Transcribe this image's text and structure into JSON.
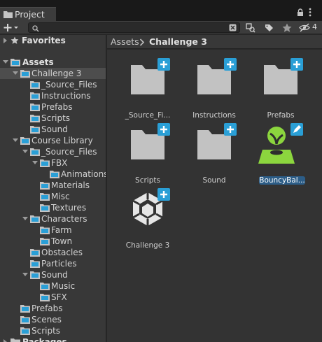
{
  "tab": {
    "label": "Project"
  },
  "toolbar": {
    "search_placeholder": "",
    "hidden_count": "4"
  },
  "tree": {
    "favorites": "Favorites",
    "assets": "Assets",
    "challenge3": "Challenge 3",
    "source_files": "_Source_Files",
    "instructions": "Instructions",
    "prefabs": "Prefabs",
    "scripts": "Scripts",
    "sound": "Sound",
    "course_library": "Course Library",
    "cl_source_files": "_Source_Files",
    "fbx": "FBX",
    "animations": "Animations",
    "materials": "Materials",
    "misc": "Misc",
    "textures": "Textures",
    "characters": "Characters",
    "farm": "Farm",
    "town": "Town",
    "obstacles": "Obstacles",
    "particles": "Particles",
    "cl_sound": "Sound",
    "music": "Music",
    "sfx": "SFX",
    "cl_prefabs": "Prefabs",
    "scenes": "Scenes",
    "cl_scripts": "Scripts",
    "packages": "Packages"
  },
  "breadcrumb": {
    "root": "Assets",
    "current": "Challenge 3"
  },
  "grid": {
    "items": [
      {
        "name": "_Source_Fi..."
      },
      {
        "name": "Instructions"
      },
      {
        "name": "Prefabs"
      },
      {
        "name": "Scripts"
      },
      {
        "name": "Sound"
      },
      {
        "name": "BouncyBal..."
      },
      {
        "name": "Challenge 3"
      }
    ]
  },
  "colors": {
    "accent_blue": "#2a9fd6",
    "selection": "#2c5d87",
    "folder_gray": "#c2c2c2",
    "prefab_green": "#8cd63e"
  }
}
